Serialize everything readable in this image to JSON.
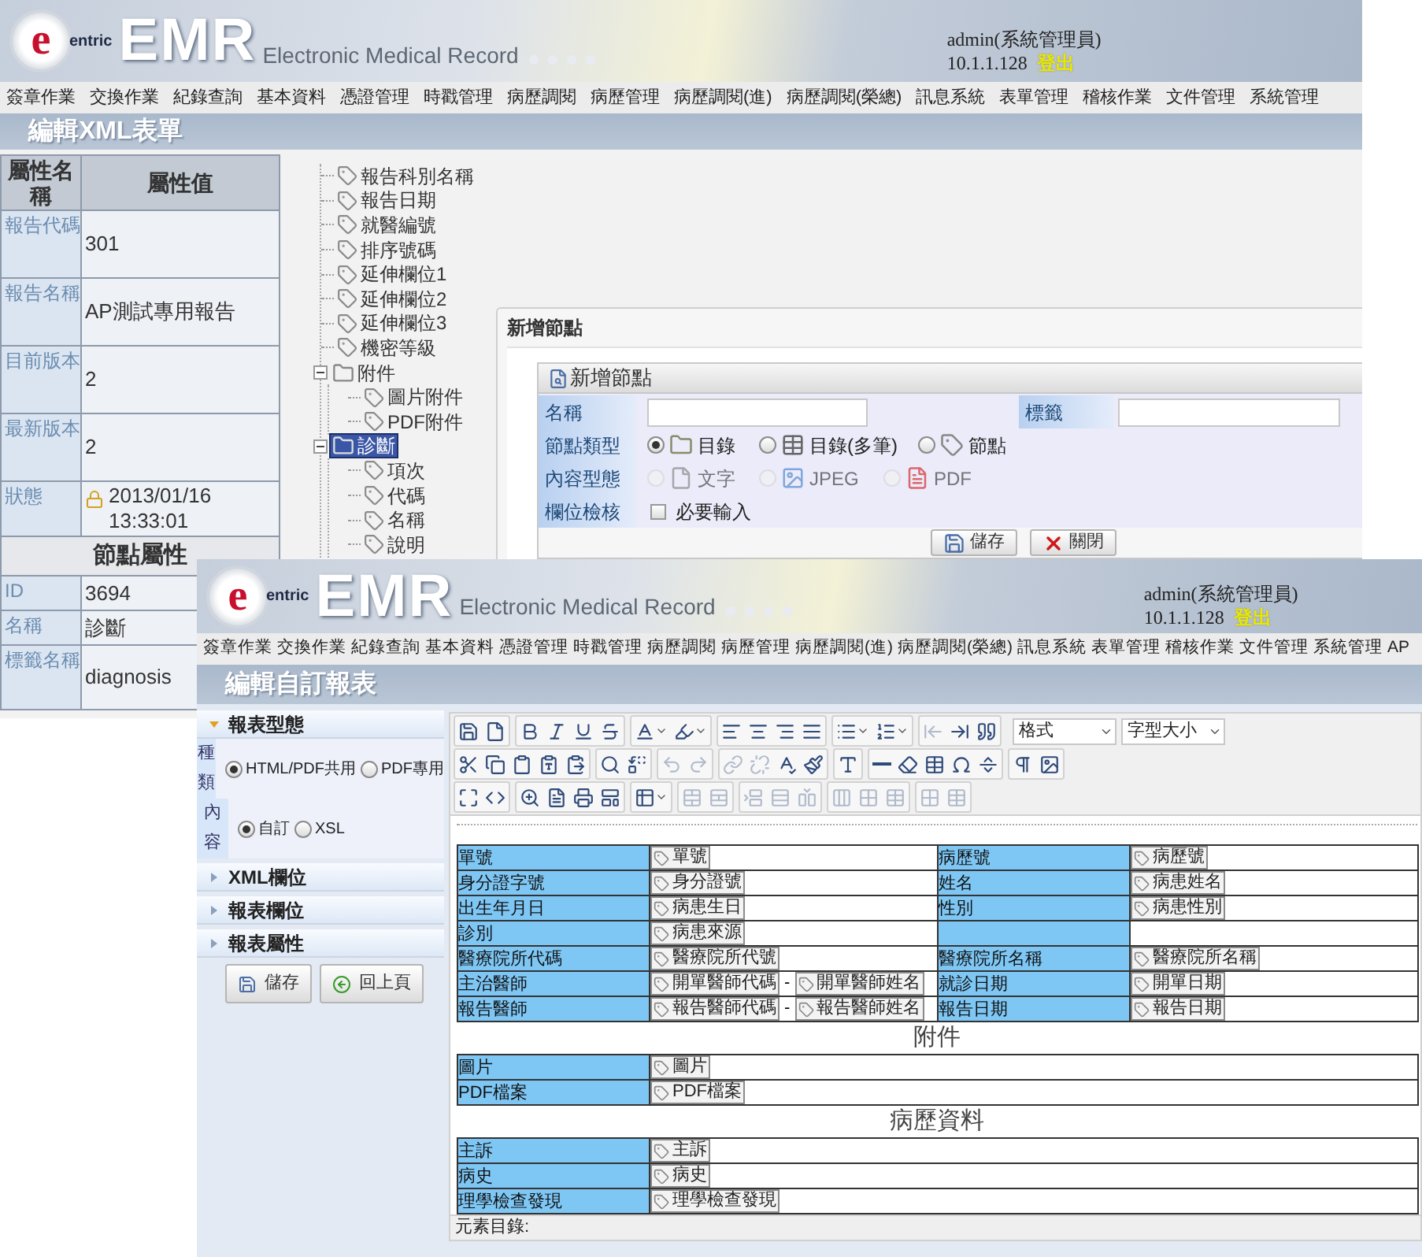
{
  "back_window": {
    "header": {
      "logo": {
        "mark": "e",
        "sub": "entric",
        "name": "EMR"
      },
      "tagline": "Electronic Medical Record",
      "user": "admin(系統管理員)",
      "ip": "10.1.1.128",
      "logout": "登出"
    },
    "menu": [
      "簽章作業",
      "交換作業",
      "紀錄查詢",
      "基本資料",
      "憑證管理",
      "時戳管理",
      "病歷調閱",
      "病歷管理",
      "病歷調閱(進)",
      "病歷調閱(榮總)",
      "訊息系統",
      "表單管理",
      "稽核作業",
      "文件管理",
      "系統管理"
    ],
    "title": "編輯XML表單",
    "properties": {
      "columns": [
        "屬性名稱",
        "屬性值"
      ],
      "rows": [
        {
          "name": "報告代碼",
          "value": "301",
          "kind": "text"
        },
        {
          "name": "報告名稱",
          "value": "AP測試專用報告",
          "kind": "text"
        },
        {
          "name": "目前版本",
          "value": "2",
          "kind": "text"
        },
        {
          "name": "最新版本",
          "value": "2",
          "kind": "text"
        },
        {
          "name": "狀態",
          "value": "2013/01/16 13:33:01",
          "kind": "status"
        }
      ],
      "section": "節點屬性",
      "node_rows": [
        {
          "name": "ID",
          "value": "3694"
        },
        {
          "name": "名稱",
          "value": "診斷"
        },
        {
          "name": "標籤名稱",
          "value": "diagnosis"
        }
      ]
    },
    "tree": [
      {
        "label": "報告科別名稱",
        "kind": "tag",
        "selected": false
      },
      {
        "label": "報告日期",
        "kind": "tag",
        "selected": false
      },
      {
        "label": "就醫編號",
        "kind": "tag",
        "selected": false
      },
      {
        "label": "排序號碼",
        "kind": "tag",
        "selected": false
      },
      {
        "label": "延伸欄位1",
        "kind": "tag",
        "selected": false
      },
      {
        "label": "延伸欄位2",
        "kind": "tag",
        "selected": false
      },
      {
        "label": "延伸欄位3",
        "kind": "tag",
        "selected": false
      },
      {
        "label": "機密等級",
        "kind": "tag",
        "selected": false
      },
      {
        "label": "附件",
        "kind": "folder",
        "expanded": true,
        "selected": false,
        "children": [
          {
            "label": "圖片附件",
            "kind": "tag",
            "selected": false
          },
          {
            "label": "PDF附件",
            "kind": "tag",
            "selected": false
          }
        ]
      },
      {
        "label": "診斷",
        "kind": "folder",
        "expanded": true,
        "selected": true,
        "children": [
          {
            "label": "項次",
            "kind": "tag",
            "selected": false
          },
          {
            "label": "代碼",
            "kind": "tag",
            "selected": false
          },
          {
            "label": "名稱",
            "kind": "tag",
            "selected": false
          },
          {
            "label": "說明",
            "kind": "tag",
            "selected": false
          }
        ]
      }
    ],
    "dialog": {
      "title": "新增節點",
      "panel_title": "新增節點",
      "name_label": "名稱",
      "tag_label": "標籤",
      "node_type": {
        "label": "節點類型",
        "disabled": false,
        "options": [
          {
            "label": "目錄",
            "kind": "folder",
            "selected": true
          },
          {
            "label": "目錄(多筆)",
            "kind": "table",
            "selected": false
          },
          {
            "label": "節點",
            "kind": "tag",
            "selected": false
          }
        ]
      },
      "content_type": {
        "label": "內容型態",
        "disabled": true,
        "options": [
          {
            "label": "文字",
            "kind": "text",
            "selected": false
          },
          {
            "label": "JPEG",
            "kind": "image",
            "selected": false
          },
          {
            "label": "PDF",
            "kind": "pdf",
            "selected": false
          }
        ]
      },
      "validation": {
        "label": "欄位檢核",
        "option": "必要輸入",
        "checked": false
      },
      "buttons": [
        {
          "label": "儲存",
          "kind": "save"
        },
        {
          "label": "關閉",
          "kind": "close"
        }
      ]
    }
  },
  "front_window": {
    "header": {
      "logo": {
        "mark": "e",
        "sub": "entric",
        "name": "EMR"
      },
      "tagline": "Electronic Medical Record",
      "user": "admin(系統管理員)",
      "ip": "10.1.1.128",
      "logout": "登出"
    },
    "menu": [
      "簽章作業",
      "交換作業",
      "紀錄查詢",
      "基本資料",
      "憑證管理",
      "時戳管理",
      "病歷調閱",
      "病歷管理",
      "病歷調閱(進)",
      "病歷調閱(榮總)",
      "訊息系統",
      "表單管理",
      "稽核作業",
      "文件管理",
      "系統管理",
      "AP"
    ],
    "title": "編輯自訂報表",
    "sidebar": {
      "sections": [
        {
          "title": "報表型態",
          "expanded": true,
          "groups": [
            {
              "label": "種類",
              "options": [
                {
                  "label": "HTML/PDF共用",
                  "selected": true
                },
                {
                  "label": "PDF專用",
                  "selected": false
                }
              ]
            },
            {
              "label": "內容",
              "options": [
                {
                  "label": "自訂",
                  "selected": true
                },
                {
                  "label": "XSL",
                  "selected": false
                }
              ]
            }
          ]
        },
        {
          "title": "XML欄位",
          "expanded": false
        },
        {
          "title": "報表欄位",
          "expanded": false
        },
        {
          "title": "報表屬性",
          "expanded": false
        }
      ],
      "buttons": [
        {
          "label": "儲存",
          "kind": "save"
        },
        {
          "label": "回上頁",
          "kind": "back"
        }
      ]
    },
    "toolbar": [
      [
        [
          {
            "kind": "save",
            "disabled": false
          },
          {
            "kind": "new-page",
            "disabled": false
          }
        ],
        [
          {
            "kind": "bold",
            "disabled": false
          },
          {
            "kind": "italic",
            "disabled": false
          },
          {
            "kind": "underline",
            "disabled": false
          },
          {
            "kind": "strike",
            "disabled": false
          }
        ],
        [
          {
            "kind": "text-color",
            "disabled": false
          },
          {
            "kind": "highlight",
            "disabled": false
          }
        ],
        [
          {
            "kind": "align-left",
            "disabled": false
          },
          {
            "kind": "align-center",
            "disabled": false
          },
          {
            "kind": "align-right",
            "disabled": false
          },
          {
            "kind": "align-justify",
            "disabled": false
          }
        ],
        [
          {
            "kind": "bullets",
            "disabled": false
          },
          {
            "kind": "numbering",
            "disabled": false
          }
        ],
        [
          {
            "kind": "outdent",
            "disabled": true
          },
          {
            "kind": "indent",
            "disabled": false
          },
          {
            "kind": "quote",
            "disabled": false
          }
        ]
      ],
      [
        [
          {
            "kind": "cut",
            "disabled": false
          },
          {
            "kind": "copy",
            "disabled": false
          },
          {
            "kind": "paste",
            "disabled": false
          },
          {
            "kind": "paste-text",
            "disabled": false
          },
          {
            "kind": "paste-word",
            "disabled": false
          }
        ],
        [
          {
            "kind": "find",
            "disabled": false
          },
          {
            "kind": "replace",
            "disabled": false
          }
        ],
        [
          {
            "kind": "undo",
            "disabled": true
          },
          {
            "kind": "redo",
            "disabled": true
          }
        ],
        [
          {
            "kind": "link",
            "disabled": true
          },
          {
            "kind": "unlink",
            "disabled": true
          },
          {
            "kind": "spellcheck",
            "disabled": false
          },
          {
            "kind": "brush",
            "disabled": false
          }
        ],
        [
          {
            "kind": "styles",
            "disabled": false
          }
        ],
        [
          {
            "kind": "hr",
            "disabled": false
          },
          {
            "kind": "eraser",
            "disabled": false
          },
          {
            "kind": "table",
            "disabled": false
          },
          {
            "kind": "omega",
            "disabled": false
          },
          {
            "kind": "separator",
            "disabled": false
          }
        ],
        [
          {
            "kind": "pilcrow",
            "disabled": false
          },
          {
            "kind": "image",
            "disabled": false
          }
        ]
      ],
      [
        [
          {
            "kind": "maximize",
            "disabled": false
          },
          {
            "kind": "html",
            "disabled": false
          }
        ],
        [
          {
            "kind": "preview",
            "disabled": false
          },
          {
            "kind": "pdf",
            "disabled": false
          },
          {
            "kind": "print",
            "disabled": false
          },
          {
            "kind": "template",
            "disabled": false
          }
        ],
        [
          {
            "kind": "table-menu",
            "disabled": false
          }
        ],
        [
          {
            "kind": "cell-merge",
            "disabled": true
          },
          {
            "kind": "cell-split",
            "disabled": true
          }
        ],
        [
          {
            "kind": "row-insert",
            "disabled": true
          },
          {
            "kind": "row-delete",
            "disabled": true
          },
          {
            "kind": "col-insert",
            "disabled": true
          }
        ],
        [
          {
            "kind": "col-delete",
            "disabled": true
          },
          {
            "kind": "cell-props",
            "disabled": true
          },
          {
            "kind": "grid",
            "disabled": true
          }
        ],
        [
          {
            "kind": "cell-props",
            "disabled": true
          },
          {
            "kind": "grid",
            "disabled": true
          }
        ]
      ]
    ],
    "selects": [
      "格式",
      "字型大小"
    ],
    "document": [
      {
        "kind": "table",
        "rows": [
          [
            {
              "kind": "label",
              "text": "單號"
            },
            {
              "kind": "fields",
              "fields": [
                "單號"
              ]
            },
            {
              "kind": "label",
              "text": "病歷號"
            },
            {
              "kind": "fields",
              "fields": [
                "病歷號"
              ]
            }
          ],
          [
            {
              "kind": "label",
              "text": "身分證字號"
            },
            {
              "kind": "fields",
              "fields": [
                "身分證號"
              ]
            },
            {
              "kind": "label",
              "text": "姓名"
            },
            {
              "kind": "fields",
              "fields": [
                "病患姓名"
              ]
            }
          ],
          [
            {
              "kind": "label",
              "text": "出生年月日"
            },
            {
              "kind": "fields",
              "fields": [
                "病患生日"
              ]
            },
            {
              "kind": "label",
              "text": "性別"
            },
            {
              "kind": "fields",
              "fields": [
                "病患性別"
              ]
            }
          ],
          [
            {
              "kind": "label",
              "text": "診別"
            },
            {
              "kind": "fields",
              "fields": [
                "病患來源"
              ]
            },
            {
              "kind": "label"
            },
            {
              "kind": "fields"
            }
          ],
          [
            {
              "kind": "label",
              "text": "醫療院所代碼"
            },
            {
              "kind": "fields",
              "fields": [
                "醫療院所代號"
              ]
            },
            {
              "kind": "label",
              "text": "醫療院所名稱"
            },
            {
              "kind": "fields",
              "fields": [
                "醫療院所名稱"
              ]
            }
          ],
          [
            {
              "kind": "label",
              "text": "主治醫師"
            },
            {
              "kind": "fields",
              "fields": [
                "開單醫師代碼",
                "開單醫師姓名"
              ],
              "separator": "-"
            },
            {
              "kind": "label",
              "text": "就診日期"
            },
            {
              "kind": "fields",
              "fields": [
                "開單日期"
              ]
            }
          ],
          [
            {
              "kind": "label",
              "text": "報告醫師"
            },
            {
              "kind": "fields",
              "fields": [
                "報告醫師代碼",
                "報告醫師姓名"
              ],
              "separator": "-"
            },
            {
              "kind": "label",
              "text": "報告日期"
            },
            {
              "kind": "fields",
              "fields": [
                "報告日期"
              ]
            }
          ]
        ]
      },
      {
        "kind": "heading",
        "text": "附件"
      },
      {
        "kind": "table",
        "rows": [
          [
            {
              "kind": "label",
              "text": "圖片"
            },
            {
              "kind": "fields",
              "fields": [
                "圖片"
              ]
            }
          ],
          [
            {
              "kind": "label",
              "text": "PDF檔案"
            },
            {
              "kind": "fields",
              "fields": [
                "PDF檔案"
              ]
            }
          ]
        ]
      },
      {
        "kind": "heading",
        "text": "病歷資料"
      },
      {
        "kind": "table",
        "rows": [
          [
            {
              "kind": "label",
              "text": "主訴"
            },
            {
              "kind": "fields",
              "fields": [
                "主訴"
              ]
            }
          ],
          [
            {
              "kind": "label",
              "text": "病史"
            },
            {
              "kind": "fields",
              "fields": [
                "病史"
              ]
            }
          ],
          [
            {
              "kind": "label",
              "text": "理學檢查發現"
            },
            {
              "kind": "fields",
              "fields": [
                "理學檢查發現"
              ]
            }
          ]
        ]
      }
    ],
    "status": "元素目錄:"
  }
}
